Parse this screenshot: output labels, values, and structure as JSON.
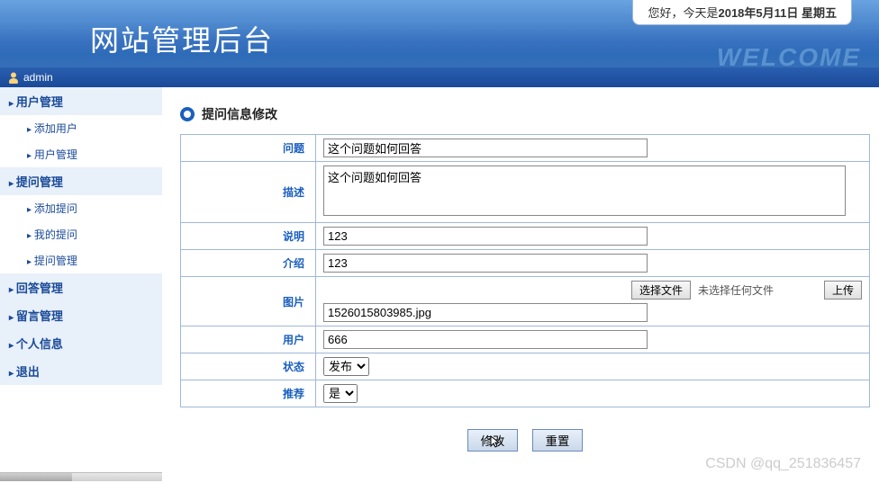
{
  "header": {
    "date_prefix": "您好，今天是",
    "date_value": "2018年5月11日 星期五",
    "site_title": "网站管理后台",
    "welcome_bg": "WELCOME"
  },
  "userbar": {
    "username": "admin"
  },
  "sidebar": {
    "groups": [
      {
        "title": "用户管理",
        "items": [
          "添加用户",
          "用户管理"
        ]
      },
      {
        "title": "提问管理",
        "items": [
          "添加提问",
          "我的提问",
          "提问管理"
        ]
      },
      {
        "title": "回答管理",
        "items": []
      },
      {
        "title": "留言管理",
        "items": []
      },
      {
        "title": "个人信息",
        "items": []
      },
      {
        "title": "退出",
        "items": []
      }
    ]
  },
  "page": {
    "title": "提问信息修改"
  },
  "form": {
    "labels": {
      "question": "问题",
      "desc": "描述",
      "explain": "说明",
      "intro": "介绍",
      "image": "图片",
      "user": "用户",
      "status": "状态",
      "recommend": "推荐"
    },
    "buttons": {
      "choose_file": "选择文件",
      "upload": "上传",
      "submit": "修改",
      "reset": "重置"
    },
    "file_placeholder": "未选择任何文件",
    "values": {
      "question": "这个问题如何回答",
      "desc": "这个问题如何回答",
      "explain": "123",
      "intro": "123",
      "image_name": "1526015803985.jpg",
      "user": "666",
      "status": "发布",
      "recommend": "是"
    }
  },
  "watermark": "CSDN @qq_251836457"
}
